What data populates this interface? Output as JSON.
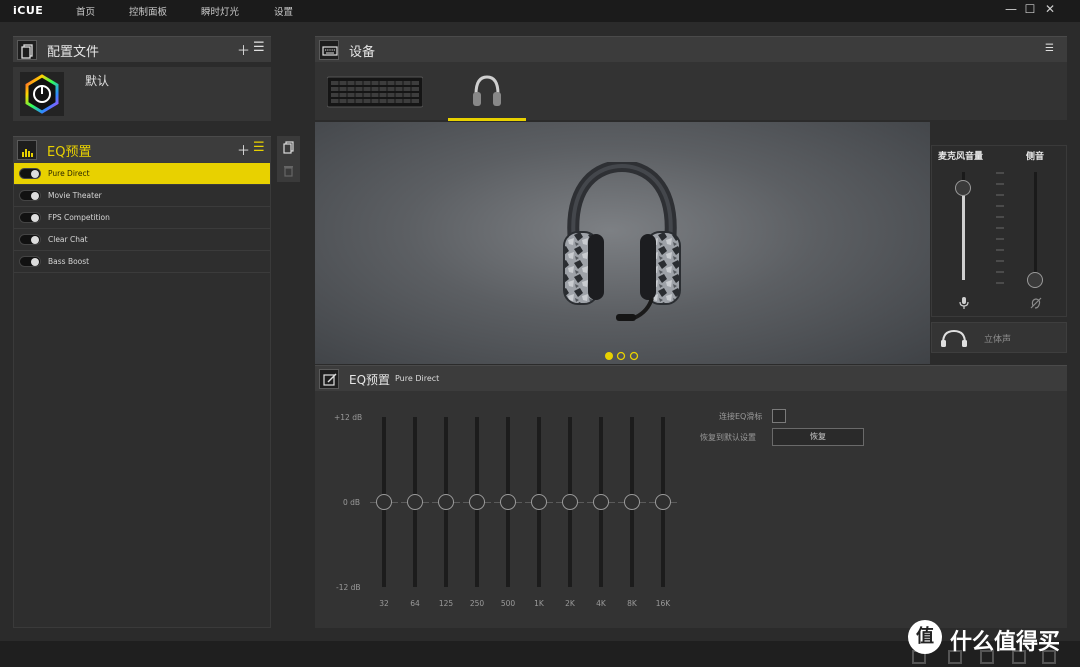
{
  "app": {
    "title": "iCUE",
    "nav": [
      "首页",
      "控制面板",
      "瞬时灯光",
      "设置"
    ]
  },
  "profiles": {
    "title": "配置文件",
    "items": [
      {
        "name": "默认"
      }
    ]
  },
  "eq_presets": {
    "title": "EQ预置",
    "items": [
      {
        "label": "Pure Direct",
        "active": true
      },
      {
        "label": "Movie Theater",
        "active": false
      },
      {
        "label": "FPS Competition",
        "active": false
      },
      {
        "label": "Clear Chat",
        "active": false
      },
      {
        "label": "Bass Boost",
        "active": false
      }
    ]
  },
  "devices": {
    "title": "设备",
    "selected": "headset",
    "pager": {
      "count": 3,
      "active": 0
    }
  },
  "mic": {
    "volume_label": "麦克风音量",
    "sidetone_label": "侧音",
    "volume_level": 0.85,
    "sidetone_level": 0.0,
    "stereo_label": "立体声"
  },
  "eq": {
    "title": "EQ预置",
    "preset_name": "Pure Direct",
    "db_top": "+12 dB",
    "db_mid": "0 dB",
    "db_bottom": "-12 dB",
    "bands": [
      {
        "freq": "32",
        "gain": 0
      },
      {
        "freq": "64",
        "gain": 0
      },
      {
        "freq": "125",
        "gain": 0
      },
      {
        "freq": "250",
        "gain": 0
      },
      {
        "freq": "500",
        "gain": 0
      },
      {
        "freq": "1K",
        "gain": 0
      },
      {
        "freq": "2K",
        "gain": 0
      },
      {
        "freq": "4K",
        "gain": 0
      },
      {
        "freq": "8K",
        "gain": 0
      },
      {
        "freq": "16K",
        "gain": 0
      }
    ],
    "link_label": "连接EQ滑标",
    "reset_label": "恢复到默认设置",
    "reset_button": "恢复"
  },
  "watermark": {
    "badge": "值",
    "text": "什么值得买"
  },
  "colors": {
    "accent": "#e8d100",
    "bg": "#2b2b2b",
    "panel_header": "#3c3c3c"
  }
}
